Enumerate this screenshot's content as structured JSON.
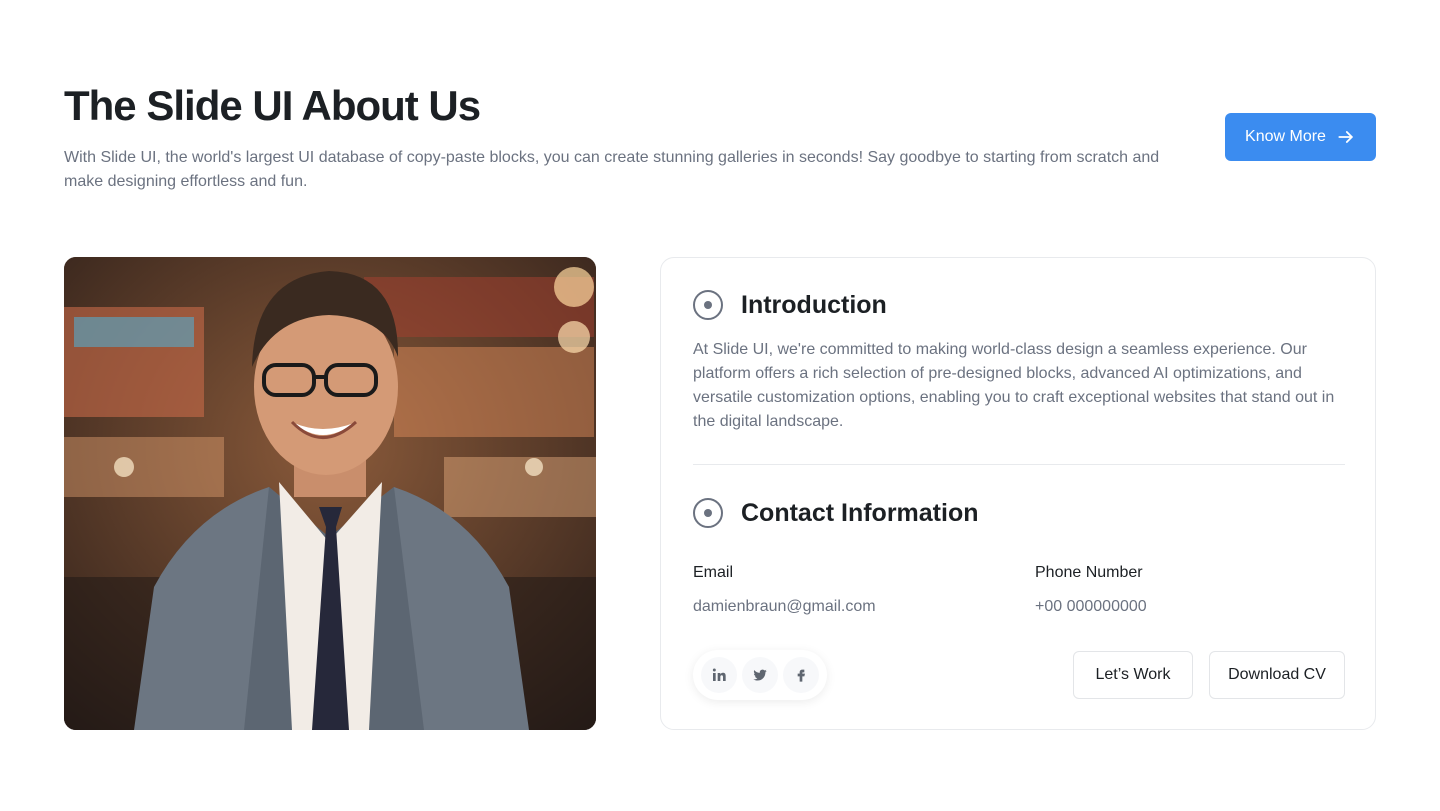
{
  "header": {
    "title": "The Slide UI About Us",
    "description": "With Slide UI, the world's largest UI database of copy-paste blocks, you can create stunning galleries in seconds! Say goodbye to starting from scratch and make designing effortless and fun.",
    "cta_label": "Know More",
    "cta_icon": "arrow-right-icon",
    "accent_color": "#3b8cf0"
  },
  "card": {
    "introduction": {
      "title": "Introduction",
      "text": "At Slide UI, we're committed to making world-class design a seamless experience. Our platform offers a rich selection of pre-designed blocks, advanced AI optimizations, and versatile customization options, enabling you to craft exceptional websites that stand out in the digital landscape."
    },
    "contact": {
      "title": "Contact Information",
      "email_label": "Email",
      "email_value": "damienbraun@gmail.com",
      "phone_label": "Phone Number",
      "phone_value": "+00 000000000"
    },
    "socials": [
      "linkedin-icon",
      "twitter-icon",
      "facebook-icon"
    ],
    "buttons": {
      "lets_work": "Let’s Work",
      "download_cv": "Download CV"
    }
  }
}
